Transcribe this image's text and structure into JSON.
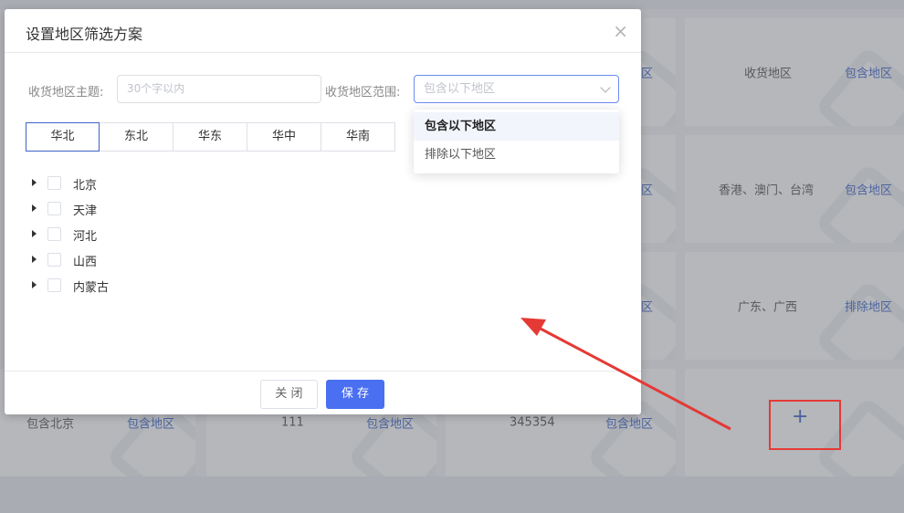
{
  "dialog": {
    "title": "设置地区筛选方案",
    "close_icon": "×",
    "theme_label": "收货地区主题:",
    "theme_placeholder": "30个字以内",
    "range_label": "收货地区范围:",
    "range_placeholder": "包含以下地区",
    "tabs": [
      "华北",
      "东北",
      "华东",
      "华中",
      "华南"
    ],
    "active_tab": "华北",
    "tree": [
      "北京",
      "天津",
      "河北",
      "山西",
      "内蒙古"
    ],
    "close_button": "关 闭",
    "save_button": "保 存"
  },
  "dropdown": {
    "options": [
      "包含以下地区",
      "排除以下地区"
    ],
    "selected": "包含以下地区"
  },
  "background": {
    "cards": [
      {
        "name": "",
        "mode": "包含地区"
      },
      {
        "name": "收货地区",
        "mode": "包含地区"
      },
      {
        "name": "",
        "mode": "包含地区"
      },
      {
        "name": "香港、澳门、台湾",
        "mode": "包含地区"
      },
      {
        "name": "",
        "mode": "包含地区"
      },
      {
        "name": "广东、广西",
        "mode": "排除地区"
      },
      {
        "name": "包含北京",
        "mode": "包含地区"
      },
      {
        "name": "111",
        "mode": "包含地区"
      },
      {
        "name": "345354",
        "mode": "包含地区"
      }
    ],
    "add_symbol": "+"
  },
  "annotation": {
    "arrow_color": "#e53935",
    "box_color": "#e53935"
  }
}
